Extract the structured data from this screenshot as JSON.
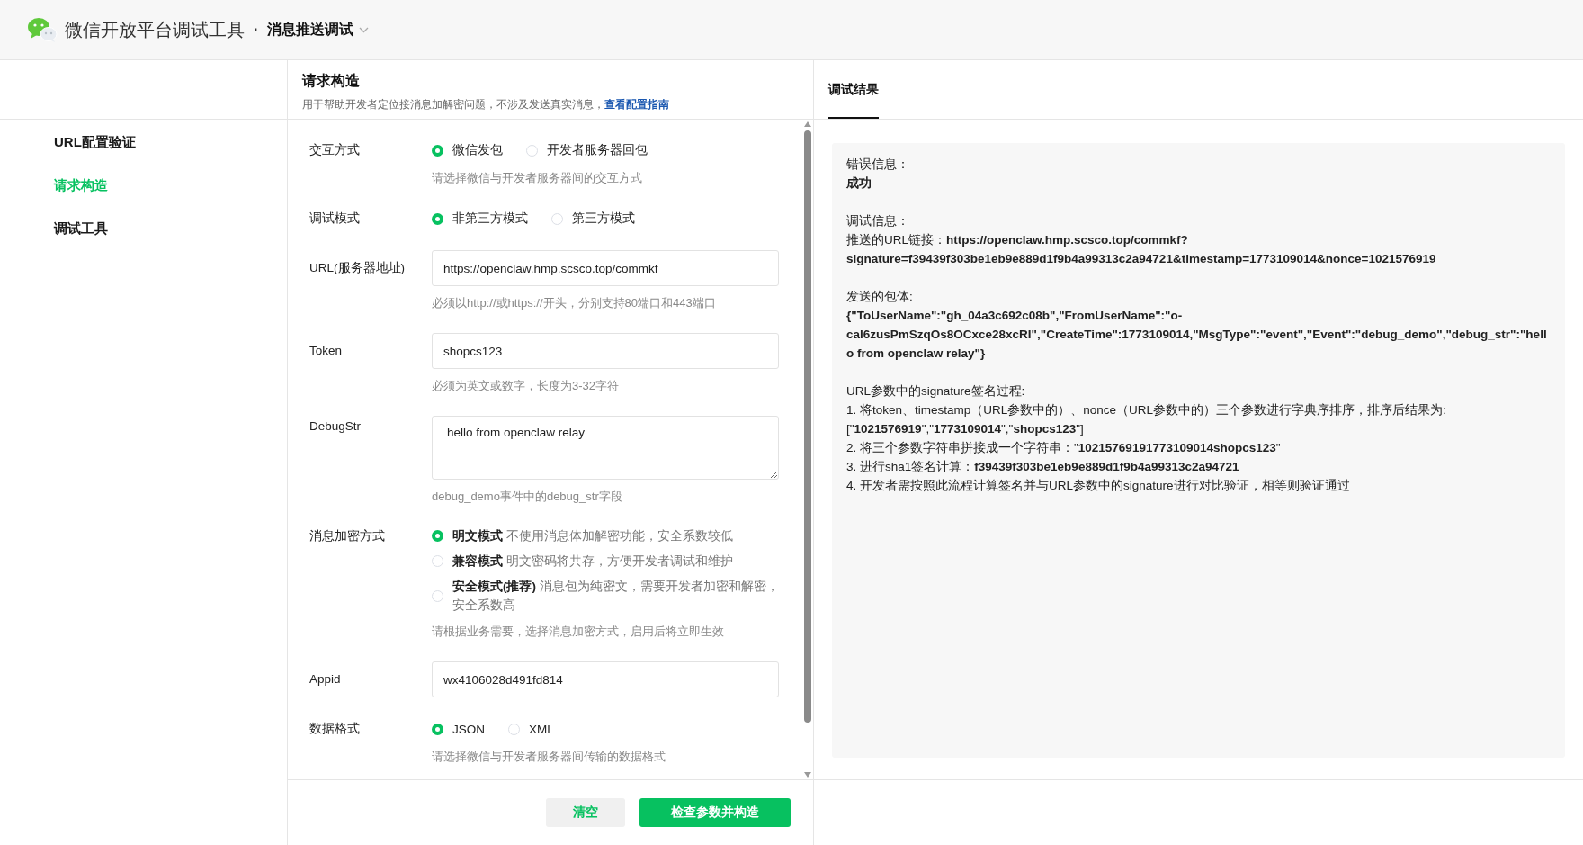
{
  "header": {
    "app_title": "微信开放平台调试工具",
    "separator": "·",
    "page_title": "消息推送调试"
  },
  "sidebar": {
    "items": [
      {
        "label": "URL配置验证",
        "selected": false
      },
      {
        "label": "请求构造",
        "selected": true
      },
      {
        "label": "调试工具",
        "selected": false
      }
    ]
  },
  "form_panel": {
    "title": "请求构造",
    "subtitle": "用于帮助开发者定位接消息加解密问题，不涉及发送真实消息，",
    "link": "查看配置指南",
    "fields": [
      {
        "kind": "radio",
        "label": "交互方式",
        "options": [
          {
            "label": "微信发包",
            "selected": true
          },
          {
            "label": "开发者服务器回包",
            "selected": false
          }
        ],
        "hint": "请选择微信与开发者服务器间的交互方式"
      },
      {
        "kind": "radio",
        "label": "调试模式",
        "options": [
          {
            "label": "非第三方模式",
            "selected": true
          },
          {
            "label": "第三方模式",
            "selected": false
          }
        ]
      },
      {
        "kind": "input",
        "label": "URL(服务器地址)",
        "value": "https://openclaw.hmp.scsco.top/commkf",
        "hint": "必须以http://或https://开头，分别支持80端口和443端口"
      },
      {
        "kind": "input",
        "label": "Token",
        "value": "shopcs123",
        "hint": "必须为英文或数字，长度为3-32字符"
      },
      {
        "kind": "textarea",
        "label": "DebugStr",
        "value": "hello from openclaw relay",
        "hint": "debug_demo事件中的debug_str字段"
      },
      {
        "kind": "radio_list",
        "label": "消息加密方式",
        "options": [
          {
            "title": "明文模式",
            "description": "不使用消息体加解密功能，安全系数较低",
            "selected": true
          },
          {
            "title": "兼容模式",
            "description": "明文密码将共存，方便开发者调试和维护",
            "selected": false
          },
          {
            "title": "安全模式(推荐)",
            "description": "消息包为纯密文，需要开发者加密和解密，安全系数高",
            "selected": false
          }
        ],
        "hint": "请根据业务需要，选择消息加密方式，启用后将立即生效"
      },
      {
        "kind": "input",
        "label": "Appid",
        "value": "wx4106028d491fd814"
      },
      {
        "kind": "radio",
        "label": "数据格式",
        "options": [
          {
            "label": "JSON",
            "selected": true
          },
          {
            "label": "XML",
            "selected": false
          }
        ],
        "hint": "请选择微信与开发者服务器间传输的数据格式"
      }
    ],
    "buttons": [
      {
        "label": "清空",
        "kind": "secondary"
      },
      {
        "label": "检查参数并构造",
        "kind": "primary"
      }
    ]
  },
  "result_panel": {
    "tab": "调试结果",
    "sections": [
      [
        "错误信息：",
        "**成功**"
      ],
      [
        "调试信息：",
        "推送的URL链接：**https://openclaw.hmp.scsco.top/commkf?signature=f39439f303be1eb9e889d1f9b4a99313c2a94721&timestamp=1773109014&nonce=1021576919**"
      ],
      [
        "发送的包体:",
        "**{\"ToUserName\":\"gh_04a3c692c08b\",\"FromUserName\":\"o-cal6zusPmSzqOs8OCxce28xcRI\",\"CreateTime\":1773109014,\"MsgType\":\"event\",\"Event\":\"debug_demo\",\"debug_str\":\"hello from openclaw relay\"}**"
      ],
      [
        "URL参数中的signature签名过程:",
        "1. 将token、timestamp（URL参数中的）、nonce（URL参数中的）三个参数进行字典序排序，排序后结果为:",
        "[\"**1021576919**\",\"**1773109014**\",\"**shopcs123**\"]",
        "2. 将三个参数字符串拼接成一个字符串：\"**10215769191773109014shopcs123**\"",
        "3. 进行sha1签名计算：**f39439f303be1eb9e889d1f9b4a99313c2a94721**",
        "4. 开发者需按照此流程计算签名并与URL参数中的signature进行对比验证，相等则验证通过"
      ]
    ]
  }
}
